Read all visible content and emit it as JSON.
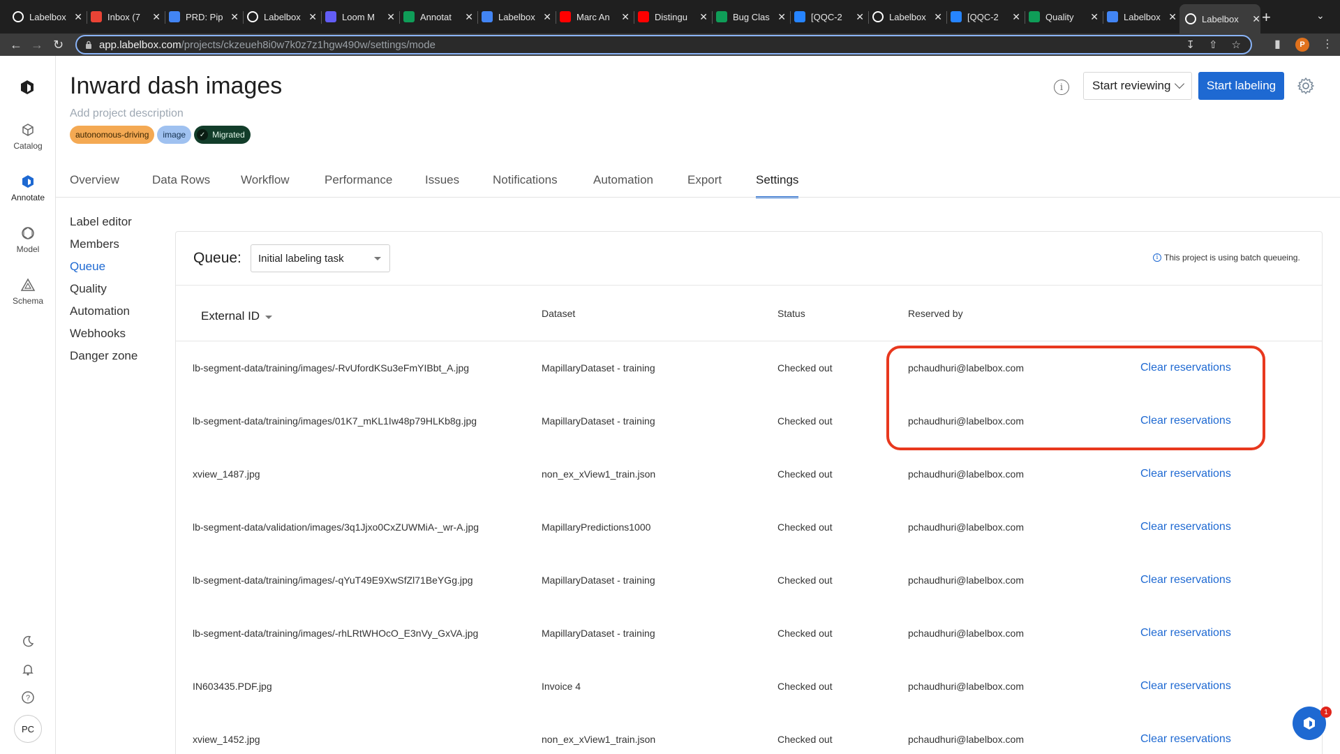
{
  "browser": {
    "tabs": [
      {
        "title": "Labelbox",
        "icon": "labelbox-icon",
        "color": "#ffffff"
      },
      {
        "title": "Inbox (7",
        "icon": "gmail-icon",
        "color": "#ea4335"
      },
      {
        "title": "PRD: Pip",
        "icon": "docs-icon",
        "color": "#4285f4"
      },
      {
        "title": "Labelbox",
        "icon": "labelbox-icon",
        "color": "#ffffff"
      },
      {
        "title": "Loom M",
        "icon": "loom-icon",
        "color": "#625df5"
      },
      {
        "title": "Annotat",
        "icon": "sheets-icon",
        "color": "#0f9d58"
      },
      {
        "title": "Labelbox",
        "icon": "calendar-icon",
        "color": "#4285f4"
      },
      {
        "title": "Marc An",
        "icon": "youtube-icon",
        "color": "#ff0000"
      },
      {
        "title": "Distingu",
        "icon": "youtube-icon",
        "color": "#ff0000"
      },
      {
        "title": "Bug Clas",
        "icon": "sheets-icon",
        "color": "#0f9d58"
      },
      {
        "title": "[QQC-2",
        "icon": "jira-icon",
        "color": "#2684ff"
      },
      {
        "title": "Labelbox",
        "icon": "labelbox-icon",
        "color": "#ffffff"
      },
      {
        "title": "[QQC-2",
        "icon": "jira-icon",
        "color": "#2684ff"
      },
      {
        "title": "Quality",
        "icon": "sheets-icon",
        "color": "#0f9d58"
      },
      {
        "title": "Labelbox",
        "icon": "book-icon",
        "color": "#4285f4"
      },
      {
        "title": "Labelbox",
        "icon": "labelbox-icon",
        "color": "#ffffff",
        "active": true
      }
    ],
    "url_host": "app.labelbox.com",
    "url_path": "/projects/ckzeueh8i0w7k0z7z1hgw490w/settings/mode",
    "profile_initial": "P"
  },
  "rail": {
    "items": [
      {
        "label": "Catalog",
        "icon": "catalog-icon"
      },
      {
        "label": "Annotate",
        "icon": "annotate-icon",
        "active": true
      },
      {
        "label": "Model",
        "icon": "model-icon"
      },
      {
        "label": "Schema",
        "icon": "schema-icon"
      }
    ],
    "avatar": "PC"
  },
  "project": {
    "title": "Inward dash images",
    "description_placeholder": "Add project description",
    "tags": [
      "autonomous-driving",
      "image",
      "Migrated"
    ],
    "start_reviewing": "Start reviewing",
    "start_labeling": "Start labeling"
  },
  "tabs": [
    "Overview",
    "Data Rows",
    "Workflow",
    "Performance",
    "Issues",
    "Notifications",
    "Automation",
    "Export",
    "Settings"
  ],
  "active_tab": "Settings",
  "settings_nav": [
    "Label editor",
    "Members",
    "Queue",
    "Quality",
    "Automation",
    "Webhooks",
    "Danger zone"
  ],
  "active_settings": "Queue",
  "queue": {
    "label": "Queue:",
    "selected": "Initial labeling task",
    "note": "This project is using batch queueing."
  },
  "table": {
    "headers": {
      "external_id": "External ID",
      "dataset": "Dataset",
      "status": "Status",
      "reserved_by": "Reserved by"
    },
    "action_label": "Clear reservations",
    "rows": [
      {
        "external_id": "lb-segment-data/training/images/-RvUfordKSu3eFmYIBbt_A.jpg",
        "dataset": "MapillaryDataset - training",
        "status": "Checked out",
        "reserved_by": "pchaudhuri@labelbox.com"
      },
      {
        "external_id": "lb-segment-data/training/images/01K7_mKL1Iw48p79HLKb8g.jpg",
        "dataset": "MapillaryDataset - training",
        "status": "Checked out",
        "reserved_by": "pchaudhuri@labelbox.com"
      },
      {
        "external_id": "xview_1487.jpg",
        "dataset": "non_ex_xView1_train.json",
        "status": "Checked out",
        "reserved_by": "pchaudhuri@labelbox.com"
      },
      {
        "external_id": "lb-segment-data/validation/images/3q1Jjxo0CxZUWMiA-_wr-A.jpg",
        "dataset": "MapillaryPredictions1000",
        "status": "Checked out",
        "reserved_by": "pchaudhuri@labelbox.com"
      },
      {
        "external_id": "lb-segment-data/training/images/-qYuT49E9XwSfZl71BeYGg.jpg",
        "dataset": "MapillaryDataset - training",
        "status": "Checked out",
        "reserved_by": "pchaudhuri@labelbox.com"
      },
      {
        "external_id": "lb-segment-data/training/images/-rhLRtWHOcO_E3nVy_GxVA.jpg",
        "dataset": "MapillaryDataset - training",
        "status": "Checked out",
        "reserved_by": "pchaudhuri@labelbox.com"
      },
      {
        "external_id": "IN603435.PDF.jpg",
        "dataset": "Invoice 4",
        "status": "Checked out",
        "reserved_by": "pchaudhuri@labelbox.com"
      },
      {
        "external_id": "xview_1452.jpg",
        "dataset": "non_ex_xView1_train.json",
        "status": "Checked out",
        "reserved_by": "pchaudhuri@labelbox.com"
      }
    ]
  },
  "help_badge_count": "1",
  "colors": {
    "accent": "#1e69d2",
    "highlight": "#e8381e"
  }
}
